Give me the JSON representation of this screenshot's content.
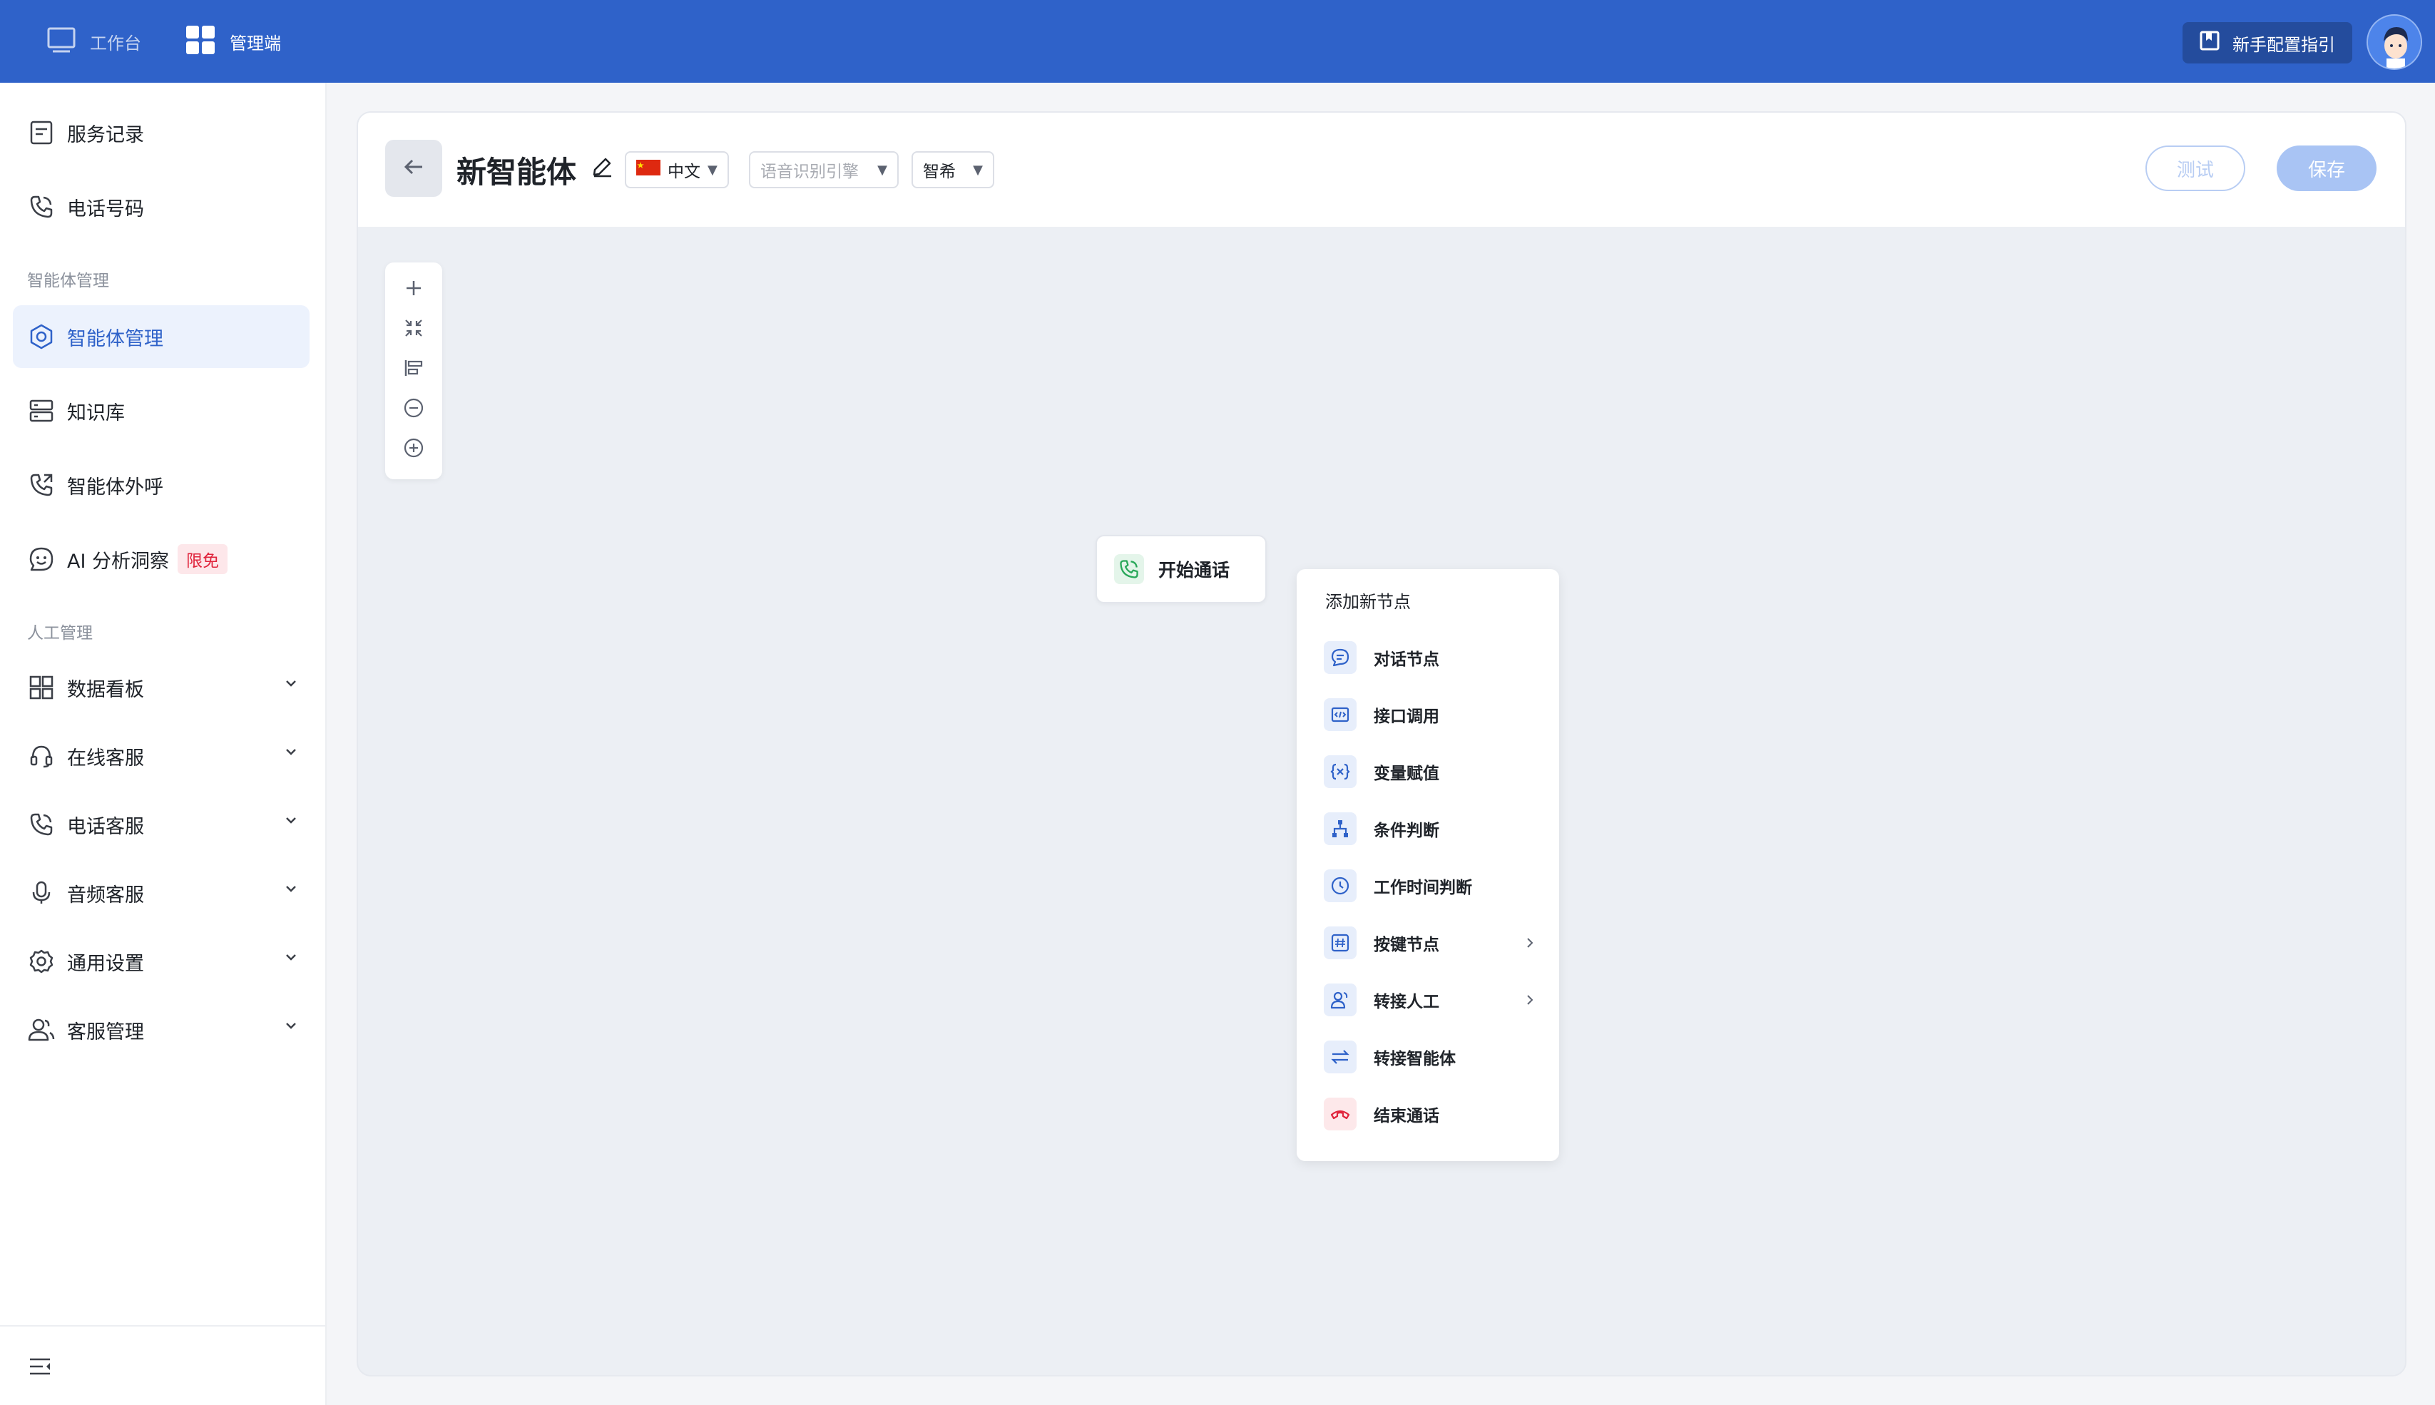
{
  "topbar": {
    "workbench": "工作台",
    "admin": "管理端",
    "guide": "新手配置指引"
  },
  "sidebar": {
    "service_records": "服务记录",
    "phone_numbers": "电话号码",
    "group_agent": "智能体管理",
    "agent_mgmt": "智能体管理",
    "knowledge": "知识库",
    "agent_outbound": "智能体外呼",
    "ai_insight": "AI 分析洞察",
    "ai_badge": "限免",
    "group_human": "人工管理",
    "dashboard": "数据看板",
    "online_cs": "在线客服",
    "phone_cs": "电话客服",
    "audio_cs": "音频客服",
    "general_settings": "通用设置",
    "cs_mgmt": "客服管理"
  },
  "header": {
    "title": "新智能体",
    "language": "中文",
    "asr_placeholder": "语音识别引擎",
    "voice": "智希",
    "test_btn": "测试",
    "save_btn": "保存"
  },
  "canvas": {
    "start_node": "开始通话"
  },
  "menu": {
    "title": "添加新节点",
    "items": [
      "对话节点",
      "接口调用",
      "变量赋值",
      "条件判断",
      "工作时间判断",
      "按键节点",
      "转接人工",
      "转接智能体",
      "结束通话"
    ]
  },
  "colors": {
    "brand": "#2f62c9",
    "active_bg": "#ecf2fd",
    "badge_red": "#e0243c",
    "canvas_bg": "#eceff4"
  }
}
